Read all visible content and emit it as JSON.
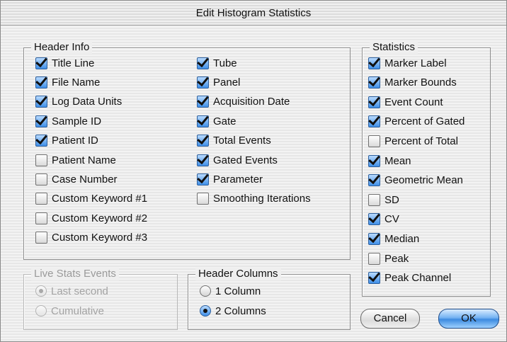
{
  "window": {
    "title": "Edit Histogram Statistics"
  },
  "header_info": {
    "legend": "Header Info",
    "col1": [
      {
        "label": "Title Line",
        "checked": true
      },
      {
        "label": "File Name",
        "checked": true
      },
      {
        "label": "Log Data Units",
        "checked": true
      },
      {
        "label": "Sample ID",
        "checked": true
      },
      {
        "label": "Patient ID",
        "checked": true
      },
      {
        "label": "Patient Name",
        "checked": false
      },
      {
        "label": "Case Number",
        "checked": false
      },
      {
        "label": "Custom Keyword #1",
        "checked": false
      },
      {
        "label": "Custom Keyword #2",
        "checked": false
      },
      {
        "label": "Custom Keyword #3",
        "checked": false
      }
    ],
    "col2": [
      {
        "label": "Tube",
        "checked": true
      },
      {
        "label": "Panel",
        "checked": true
      },
      {
        "label": "Acquisition Date",
        "checked": true
      },
      {
        "label": "Gate",
        "checked": true
      },
      {
        "label": "Total Events",
        "checked": true
      },
      {
        "label": "Gated Events",
        "checked": true
      },
      {
        "label": "Parameter",
        "checked": true
      },
      {
        "label": "Smoothing Iterations",
        "checked": false
      }
    ]
  },
  "statistics": {
    "legend": "Statistics",
    "items": [
      {
        "label": "Marker Label",
        "checked": true
      },
      {
        "label": "Marker Bounds",
        "checked": true
      },
      {
        "label": "Event Count",
        "checked": true
      },
      {
        "label": "Percent of Gated",
        "checked": true
      },
      {
        "label": "Percent of Total",
        "checked": false
      },
      {
        "label": "Mean",
        "checked": true
      },
      {
        "label": "Geometric Mean",
        "checked": true
      },
      {
        "label": "SD",
        "checked": false
      },
      {
        "label": "CV",
        "checked": true
      },
      {
        "label": "Median",
        "checked": true
      },
      {
        "label": "Peak",
        "checked": false
      },
      {
        "label": "Peak Channel",
        "checked": true
      }
    ]
  },
  "live_stats": {
    "legend": "Live Stats Events",
    "enabled": false,
    "options": [
      {
        "label": "Last second",
        "selected": true
      },
      {
        "label": "Cumulative",
        "selected": false
      }
    ]
  },
  "header_columns": {
    "legend": "Header Columns",
    "options": [
      {
        "label": "1 Column",
        "selected": false
      },
      {
        "label": "2 Columns",
        "selected": true
      }
    ]
  },
  "buttons": {
    "cancel": "Cancel",
    "ok": "OK"
  },
  "colors": {
    "accent": "#3d8be0",
    "disabled_text": "#a3a3a3"
  }
}
